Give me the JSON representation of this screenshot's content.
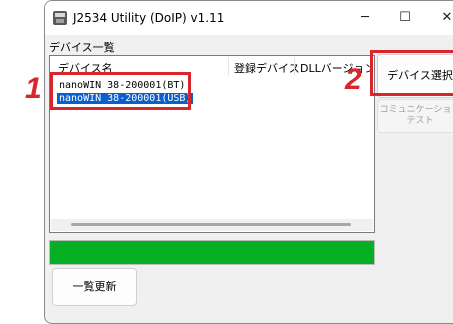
{
  "window": {
    "title": "J2534 Utility (DoIP) v1.11",
    "controls": {
      "minimize": "─",
      "maximize": "☐",
      "close": "✕"
    }
  },
  "device_list": {
    "label": "デバイス一覧",
    "columns": [
      "デバイス名",
      "登録デバイス",
      "DLLバージョン"
    ],
    "rows": [
      {
        "name": "nanoWIN 38-200001(BT)",
        "selected": false
      },
      {
        "name": "nanoWIN 38-200001(USB)",
        "selected": true
      }
    ]
  },
  "progress": {
    "value": 1.0,
    "color": "#06b025"
  },
  "buttons": {
    "select_device": "デバイス選択",
    "comm_test_line1": "コミュニケーション",
    "comm_test_line2": "テスト",
    "refresh": "一覧更新"
  },
  "annotations": {
    "marker1": "1",
    "marker2": "2",
    "color": "#d9262c"
  }
}
